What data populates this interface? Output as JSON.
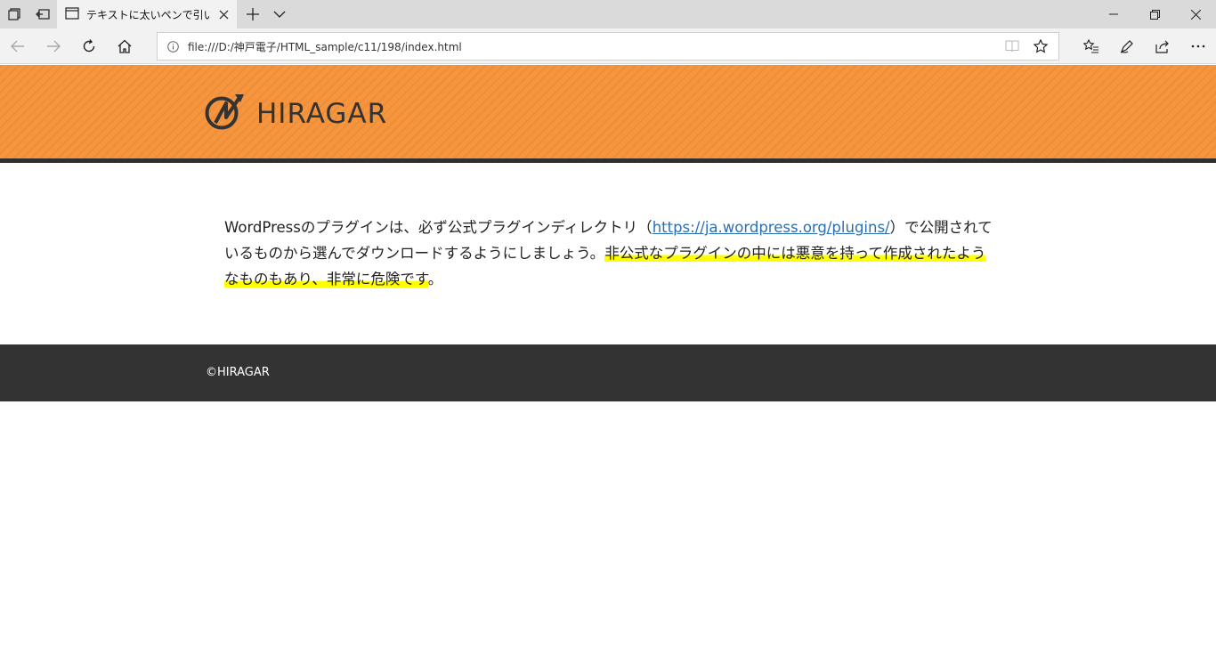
{
  "browser": {
    "tab_title": "テキストに太いペンで引いた",
    "url": "file:///D:/神戸電子/HTML_sample/c11/198/index.html",
    "icons": [
      "tab-manager-icon",
      "back-tabs-icon",
      "tab-page-icon",
      "close-icon",
      "new-tab-icon",
      "chevron-down-icon",
      "minimize-icon",
      "restore-icon",
      "window-close-icon",
      "back-icon",
      "forward-icon",
      "refresh-icon",
      "home-icon",
      "info-icon",
      "reading-view-icon",
      "favorite-star-icon",
      "favorites-list-icon",
      "pen-icon",
      "share-icon",
      "more-icon"
    ]
  },
  "site": {
    "logo_text": "HIRAGAR",
    "header_color": "#f6953d",
    "paragraph": {
      "before_link": "WordPressのプラグインは、必ず公式プラグインディレクトリ（",
      "link_text": "https://ja.wordpress.org/plugins/",
      "after_link": "）で公開されているものから選んでダウンロードするようにしましょう。",
      "highlighted": "非公式なプラグインの中には悪意を持って作成されたようなものもあり、非常に危険です",
      "end": "。"
    },
    "highlight_color": "#ffff00",
    "footer_text": "©HIRAGAR"
  }
}
